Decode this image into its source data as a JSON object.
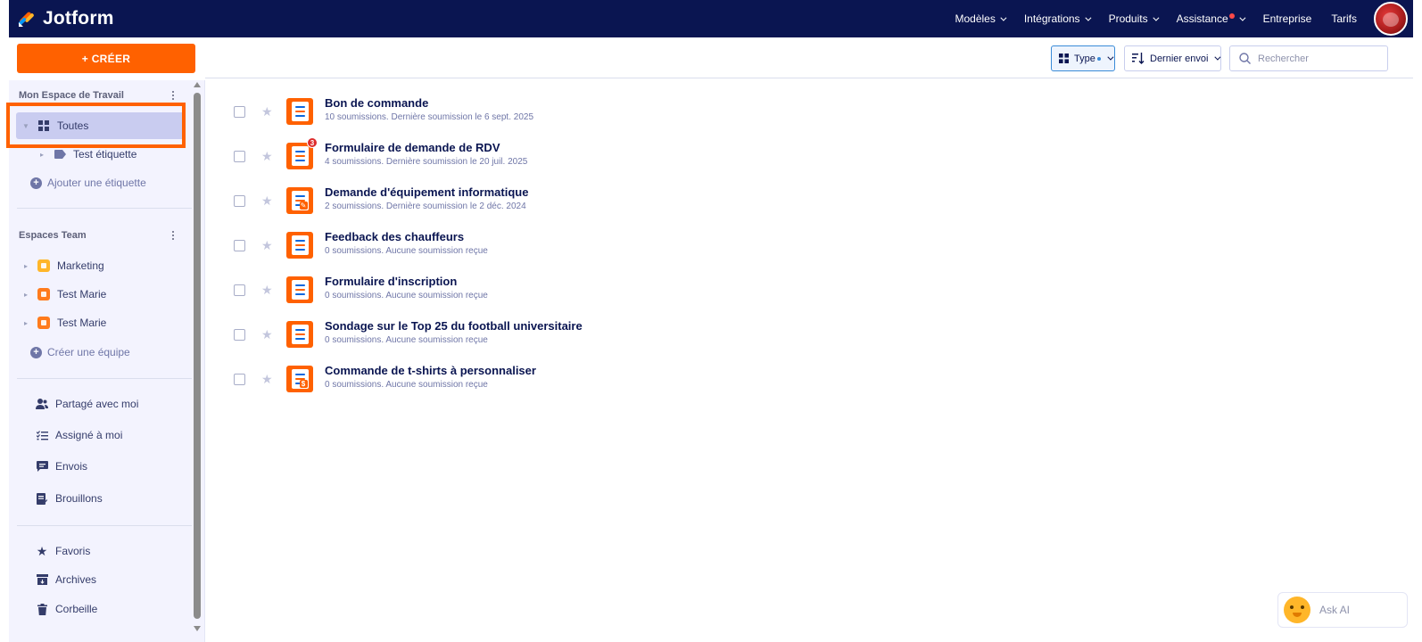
{
  "app": {
    "brand": "Jotform"
  },
  "topnav": {
    "items": [
      {
        "label": "Modèles",
        "has_chevron": true
      },
      {
        "label": "Intégrations",
        "has_chevron": true
      },
      {
        "label": "Produits",
        "has_chevron": true
      },
      {
        "label": "Assistance",
        "has_chevron": true,
        "notification_dot": true
      },
      {
        "label": "Entreprise",
        "has_chevron": false
      },
      {
        "label": "Tarifs",
        "has_chevron": false
      }
    ]
  },
  "sidebar": {
    "create_label": "+ CRÉER",
    "workspace_title": "Mon Espace de Travail",
    "workspace_items": [
      {
        "label": "Toutes",
        "icon": "grid-icon",
        "active": true
      },
      {
        "label": "Test étiquette",
        "icon": "tag-icon",
        "active": false
      }
    ],
    "add_label": "Ajouter une étiquette",
    "teams_title": "Espaces Team",
    "teams": [
      {
        "label": "Marketing",
        "badge_color": "#ffb629"
      },
      {
        "label": "Test Marie",
        "badge_color": "#ff7b1c"
      },
      {
        "label": "Test Marie",
        "badge_color": "#ff7b1c"
      }
    ],
    "create_team_label": "Créer une équipe",
    "utility_items": [
      {
        "label": "Partagé avec moi",
        "icon": "shared-user-icon"
      },
      {
        "label": "Assigné à moi",
        "icon": "assigned-list-icon"
      },
      {
        "label": "Envois",
        "icon": "message-icon"
      },
      {
        "label": "Brouillons",
        "icon": "draft-icon"
      }
    ],
    "bottom_items": [
      {
        "label": "Favoris",
        "icon": "star-icon"
      },
      {
        "label": "Archives",
        "icon": "archive-icon"
      },
      {
        "label": "Corbeille",
        "icon": "trash-icon"
      }
    ]
  },
  "toolbar": {
    "type_label": "Type",
    "sort_label": "Dernier envoi",
    "search_placeholder": "Rechercher"
  },
  "forms": [
    {
      "title": "Bon de commande",
      "subtitle": "10 soumissions. Dernière soumission le 6 sept. 2025",
      "badge": null,
      "corner": null
    },
    {
      "title": "Formulaire de demande de RDV",
      "subtitle": "4 soumissions. Dernière soumission le 20 juil. 2025",
      "badge": "3",
      "corner": null
    },
    {
      "title": "Demande d'équipement informatique",
      "subtitle": "2 soumissions. Dernière soumission le 2 déc. 2024",
      "badge": null,
      "corner": "✎"
    },
    {
      "title": "Feedback des chauffeurs",
      "subtitle": "0 soumissions. Aucune soumission reçue",
      "badge": null,
      "corner": null
    },
    {
      "title": "Formulaire d'inscription",
      "subtitle": "0 soumissions. Aucune soumission reçue",
      "badge": null,
      "corner": null
    },
    {
      "title": "Sondage sur le Top 25 du football universitaire",
      "subtitle": "0 soumissions. Aucune soumission reçue",
      "badge": null,
      "corner": null
    },
    {
      "title": "Commande de t-shirts à personnaliser",
      "subtitle": "0 soumissions. Aucune soumission reçue",
      "badge": null,
      "corner": "$"
    }
  ],
  "ask_ai": {
    "label": "Ask AI"
  },
  "colors": {
    "nav_bg": "#0a1551",
    "accent_orange": "#ff6100",
    "sidebar_bg": "#f3f3fe",
    "active_item_bg": "#c9ccf0"
  }
}
